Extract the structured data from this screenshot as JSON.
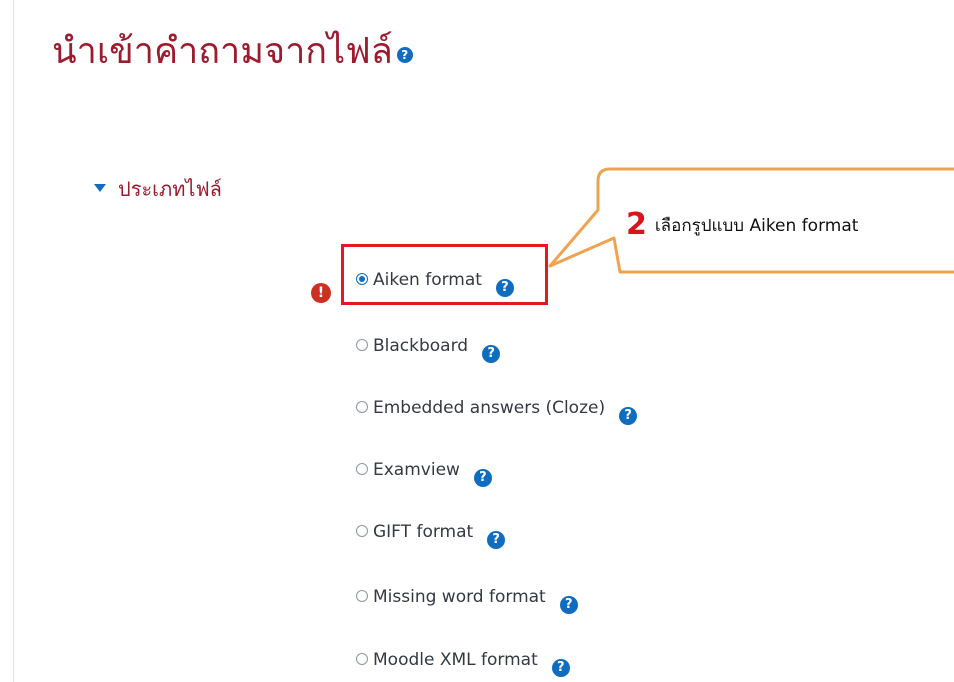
{
  "page": {
    "title": "นำเข้าคำถามจากไฟล์"
  },
  "section": {
    "label": "ประเภทไฟล์"
  },
  "icons": {
    "help": "?",
    "required": "!"
  },
  "options": [
    {
      "label": "Aiken format",
      "selected": true
    },
    {
      "label": "Blackboard",
      "selected": false
    },
    {
      "label": "Embedded answers (Cloze)",
      "selected": false
    },
    {
      "label": "Examview",
      "selected": false
    },
    {
      "label": "GIFT format",
      "selected": false
    },
    {
      "label": "Missing word format",
      "selected": false
    },
    {
      "label": "Moodle XML format",
      "selected": false
    }
  ],
  "callout": {
    "step": "2",
    "text": "เลือกรูปแบบ Aiken format"
  },
  "colors": {
    "title": "#9c1c2e",
    "accent": "#0f6cbf",
    "required": "#ca3120",
    "highlight": "#e8161d",
    "callout_border": "#f0a24e"
  }
}
